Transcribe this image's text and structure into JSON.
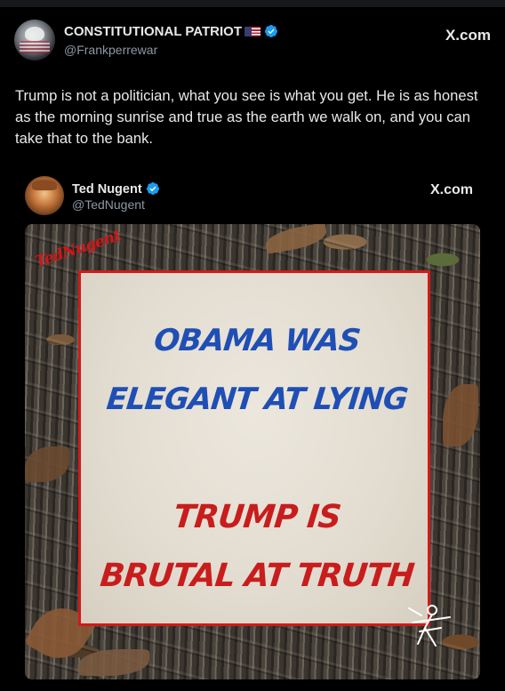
{
  "post": {
    "author_name": "CONSTITUTIONAL PATRIOT",
    "author_handle": "@Frankperrewar",
    "site_label": "X.com",
    "text": "Trump is not a politician, what you see is what you get.  He is as honest as the morning sunrise and true as the earth we walk on, and you can take that to the bank."
  },
  "quoted_post": {
    "author_name": "Ted Nugent",
    "author_handle": "@TedNugent",
    "site_label": "X.com",
    "image": {
      "logo_text": "TedNugent",
      "line1": "OBAMA WAS",
      "line2": "ELEGANT AT LYING",
      "line3": "TRUMP IS",
      "line4": "BRUTAL AT TRUTH"
    }
  },
  "colors": {
    "background": "#000000",
    "verified_badge": "#1d9bf0",
    "handle_text": "#8b98a5",
    "sign_border": "#d11a1a",
    "blue_text": "#1f4fb5",
    "red_text": "#c81d1d"
  },
  "icons": [
    "verified-badge-icon",
    "x-logo",
    "us-flag-emoji"
  ]
}
